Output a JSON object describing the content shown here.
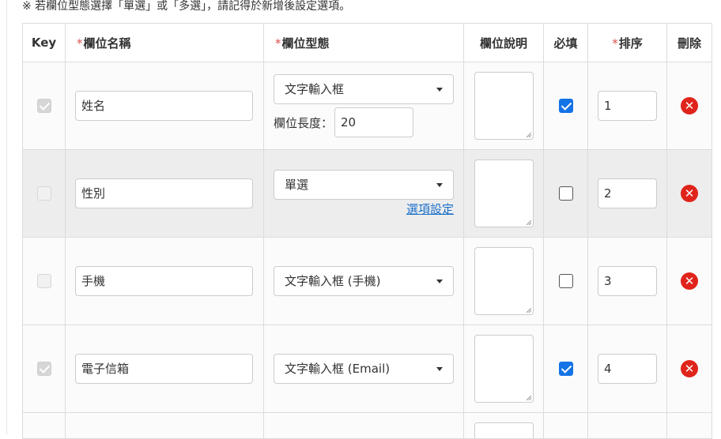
{
  "notice": "※ 若欄位型態選擇「單選」或「多選」，請記得於新增後設定選項。",
  "colors": {
    "required_mark": "#d9534f",
    "checkbox_checked": "#1473e6",
    "delete_icon": "#e0241b",
    "link": "#1a6fc9"
  },
  "headers": {
    "key": "Key",
    "name": "欄位名稱",
    "type": "欄位型態",
    "desc": "欄位說明",
    "required": "必填",
    "sort": "排序",
    "delete": "刪除",
    "required_mark": "*"
  },
  "rows": [
    {
      "key_checked": true,
      "key_disabled": true,
      "name": "姓名",
      "type": "文字輸入框",
      "length_label": "欄位長度：",
      "length": "20",
      "desc": "",
      "required": true,
      "sort": "1"
    },
    {
      "key_checked": false,
      "key_disabled": true,
      "name": "性別",
      "type": "單選",
      "option_link": "選項設定",
      "desc": "",
      "required": false,
      "sort": "2"
    },
    {
      "key_checked": false,
      "key_disabled": true,
      "name": "手機",
      "type": "文字輸入框 (手機)",
      "desc": "",
      "required": false,
      "sort": "3"
    },
    {
      "key_checked": true,
      "key_disabled": true,
      "name": "電子信箱",
      "type": "文字輸入框 (Email)",
      "desc": "",
      "required": true,
      "sort": "4"
    }
  ],
  "icons": {
    "delete": "delete-circle-x-icon",
    "dropdown": "caret-down-icon"
  },
  "delete_glyph": "✕"
}
